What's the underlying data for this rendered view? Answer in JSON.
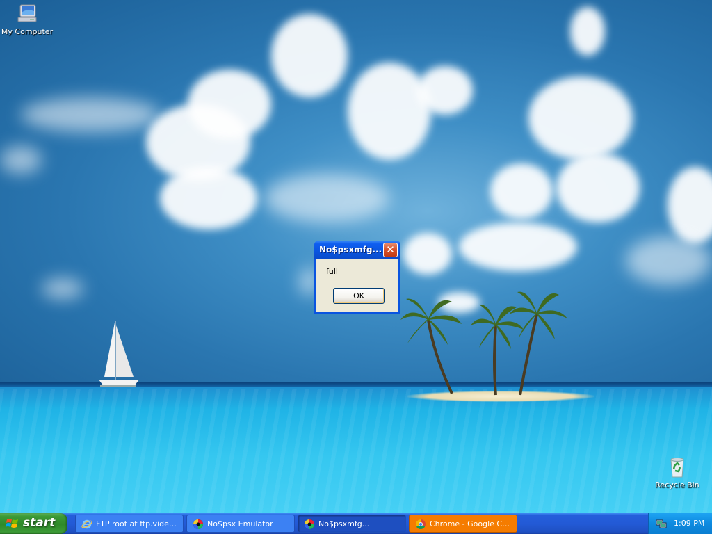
{
  "desktop": {
    "icons": [
      {
        "label": "My Computer",
        "icon": "my-computer-icon"
      },
      {
        "label": "Recycle Bin",
        "icon": "recycle-bin-icon"
      }
    ]
  },
  "dialog": {
    "title": "No$psxmfg...",
    "message": "full",
    "ok_label": "OK",
    "close_glyph": "✕"
  },
  "taskbar": {
    "start_label": "start",
    "buttons": [
      {
        "label": "FTP root at ftp.videol...",
        "icon": "internet-explorer-icon",
        "state": "normal"
      },
      {
        "label": "No$psx Emulator",
        "icon": "nocash-psx-icon",
        "state": "normal"
      },
      {
        "label": "No$psxmfg...",
        "icon": "nocash-psx-icon",
        "state": "active"
      },
      {
        "label": "Chrome - Google Chr...",
        "icon": "chrome-icon",
        "state": "flashing"
      }
    ],
    "clock": "1:09 PM"
  },
  "colors": {
    "dialog_frame": "#0a54e0",
    "dialog_body": "#ece9d8",
    "taskbar": "#245edb",
    "start_button": "#3c9a36",
    "flashing_task": "#f57c00",
    "tray": "#0d8ae0"
  }
}
